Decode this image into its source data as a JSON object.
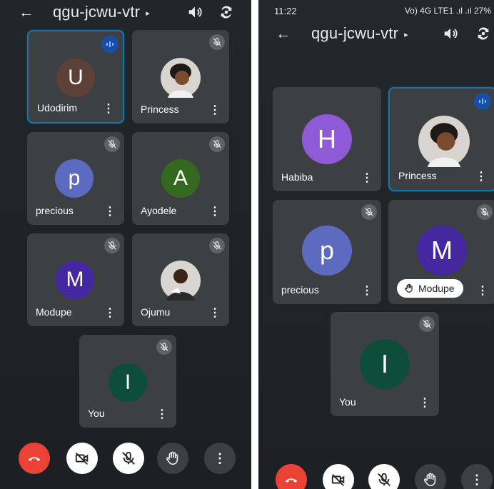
{
  "left": {
    "title": "qgu-jcwu-vtr",
    "tiles": [
      {
        "name": "Udodirim",
        "initial": "U",
        "color": "#5d4037"
      },
      {
        "name": "Princess"
      },
      {
        "name": "precious",
        "initial": "p",
        "color": "#5c6bc0"
      },
      {
        "name": "Ayodele",
        "initial": "A",
        "color": "#33691e"
      },
      {
        "name": "Modupe",
        "initial": "M",
        "color": "#4527a0"
      },
      {
        "name": "Ojumu"
      },
      {
        "name": "You",
        "initial": "I",
        "color": "#0d4d3a"
      }
    ]
  },
  "right": {
    "status": {
      "time": "11:22",
      "indicators": "Vo) 4G LTE1 .ıl .ıl 27%"
    },
    "title": "qgu-jcwu-vtr",
    "tiles": [
      {
        "name": "Habiba",
        "initial": "H",
        "color": "#8e5ad6"
      },
      {
        "name": "Princess"
      },
      {
        "name": "precious",
        "initial": "p",
        "color": "#5c6bc0"
      },
      {
        "name": "Modupe",
        "initial": "M",
        "color": "#4527a0",
        "hand_raised": true
      },
      {
        "name": "You",
        "initial": "I",
        "color": "#0d4d3a"
      }
    ]
  },
  "more_glyph": "⋮",
  "back_glyph": "←",
  "caret_glyph": "▸"
}
